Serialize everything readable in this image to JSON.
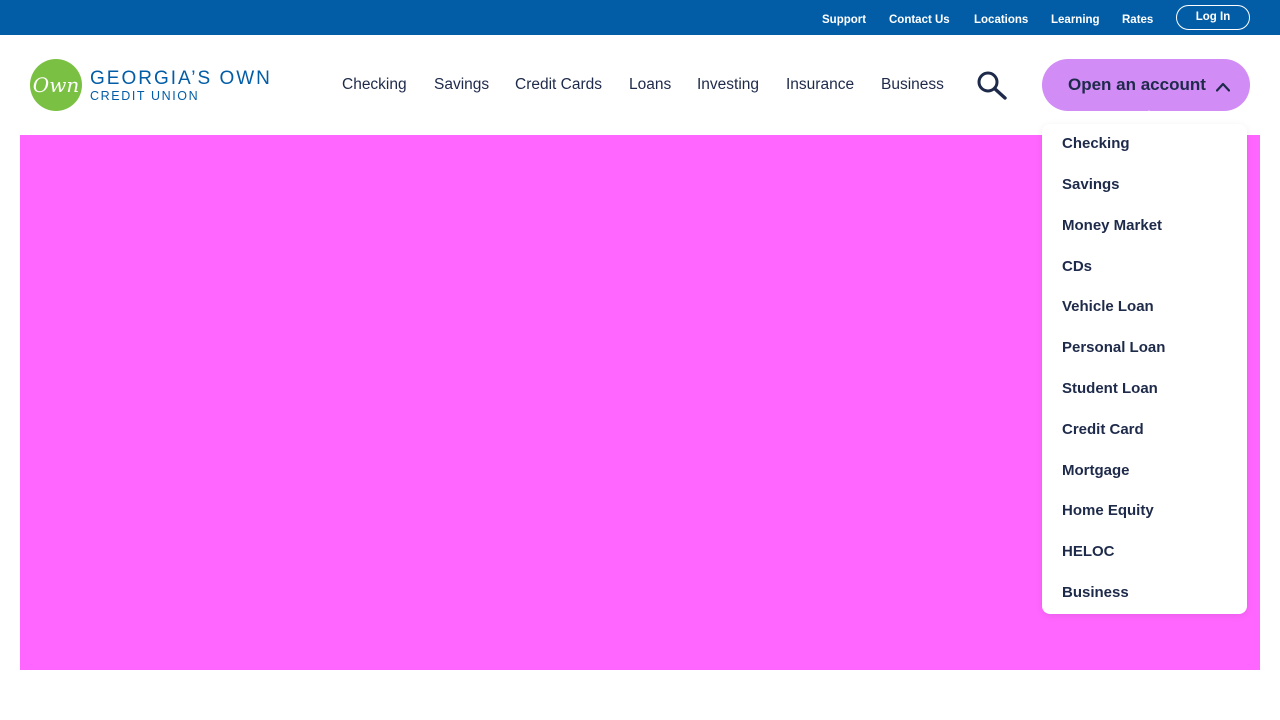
{
  "utility_nav": {
    "support": "Support",
    "contact_us": "Contact Us",
    "locations": "Locations",
    "learning": "Learning",
    "rates": "Rates",
    "log_in": "Log In"
  },
  "brand": {
    "logo_mark": "Own",
    "name": "GEORGIA’S OWN",
    "sub": "CREDIT UNION"
  },
  "main_nav": {
    "checking": "Checking",
    "savings": "Savings",
    "credit_cards": "Credit Cards",
    "loans": "Loans",
    "investing": "Investing",
    "insurance": "Insurance",
    "business": "Business"
  },
  "open_account": {
    "label": "Open an account",
    "items": [
      "Checking",
      "Savings",
      "Money Market",
      "CDs",
      "Vehicle Loan",
      "Personal Loan",
      "Student Loan",
      "Credit Card",
      "Mortgage",
      "Home Equity",
      "HELOC",
      "Business"
    ]
  },
  "icons": {
    "search": "search-icon",
    "chevron": "chevron-up-icon"
  },
  "colors": {
    "top_bar": "#035da6",
    "brand_blue": "#035da6",
    "brand_green": "#7ac143",
    "cta_purple": "#d18cf6",
    "hero": "#ff66ff",
    "text_dark": "#1e2a4a"
  }
}
